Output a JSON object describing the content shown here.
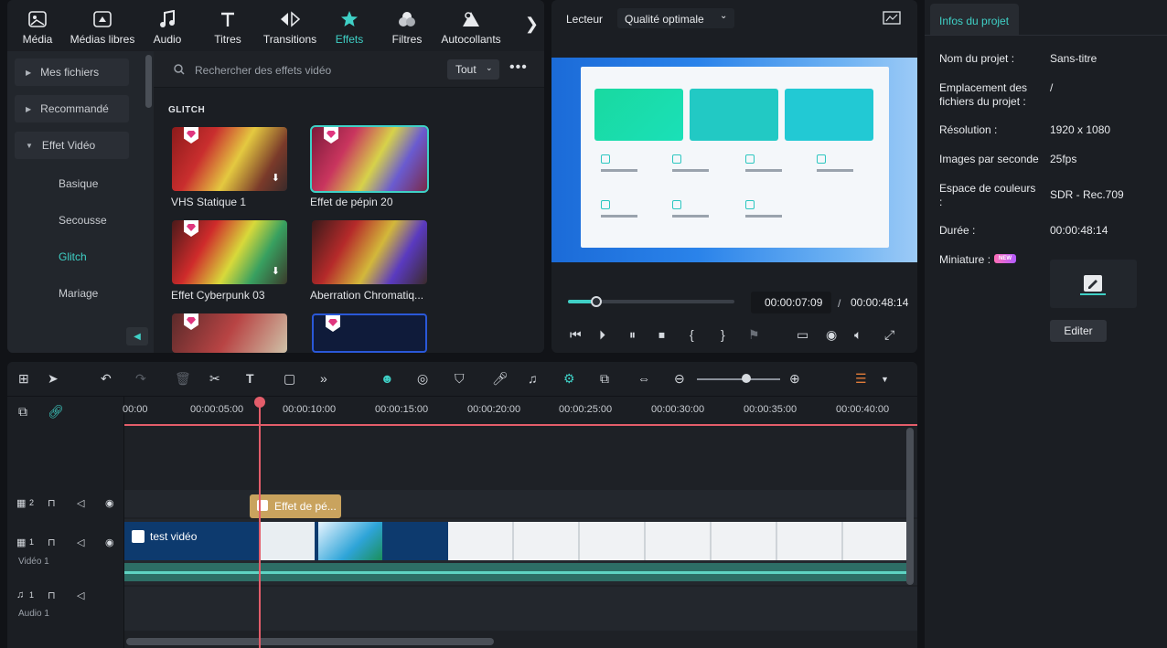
{
  "tabs": [
    {
      "label": "Média",
      "icon": "media-icon"
    },
    {
      "label": "Médias libres",
      "icon": "stock-media-icon"
    },
    {
      "label": "Audio",
      "icon": "music-note-icon"
    },
    {
      "label": "Titres",
      "icon": "title-icon"
    },
    {
      "label": "Transitions",
      "icon": "transitions-icon"
    },
    {
      "label": "Effets",
      "icon": "effects-star-icon",
      "active": true
    },
    {
      "label": "Filtres",
      "icon": "filters-icon"
    },
    {
      "label": "Autocollants",
      "icon": "stickers-icon"
    }
  ],
  "tabs_next": "❯",
  "sidebar": {
    "items": [
      "Mes fichiers",
      "Recommandé",
      "Effet Vidéo"
    ],
    "subitems": [
      "Basique",
      "Secousse",
      "Glitch",
      "Mariage"
    ],
    "active_subitem": "Glitch"
  },
  "search": {
    "placeholder": "Rechercher des effets vidéo",
    "filter": "Tout",
    "more": "•••"
  },
  "effects": {
    "section_title": "GLITCH",
    "items": [
      {
        "label": "VHS Statique 1"
      },
      {
        "label": "Effet de pépin 20"
      },
      {
        "label": "Effet Cyberpunk 03"
      },
      {
        "label": "Aberration Chromatiq..."
      }
    ]
  },
  "player": {
    "label": "Lecteur",
    "quality": "Qualité optimale",
    "current_time": "00:00:07:09",
    "separator": "/",
    "total_time": "00:00:48:14",
    "progress_fraction": 0.17
  },
  "info": {
    "tab": "Infos du projet",
    "rows": [
      {
        "label": "Nom du projet :",
        "value": "Sans-titre"
      },
      {
        "label": "Emplacement des fichiers du projet :",
        "value": "/"
      },
      {
        "label": "Résolution :",
        "value": "1920 x 1080"
      },
      {
        "label": "Images par seconde",
        "value": "25fps"
      },
      {
        "label": "Espace de couleurs :",
        "value": "SDR - Rec.709"
      },
      {
        "label": "Durée :",
        "value": "00:00:48:14"
      }
    ],
    "thumbnail_label": "Miniature :",
    "new_badge": "NEW",
    "edit_button": "Editer"
  },
  "timeline": {
    "ruler": [
      "00:00",
      "00:00:05:00",
      "00:00:10:00",
      "00:00:15:00",
      "00:00:20:00",
      "00:00:25:00",
      "00:00:30:00",
      "00:00:35:00",
      "00:00:40:00"
    ],
    "tracks": [
      {
        "num": "2",
        "name": ""
      },
      {
        "num": "1",
        "name": "Vidéo 1"
      },
      {
        "num": "1",
        "name": "Audio 1"
      }
    ],
    "effect_clip": "Effet de pé...",
    "video_clip": "test vidéo"
  }
}
